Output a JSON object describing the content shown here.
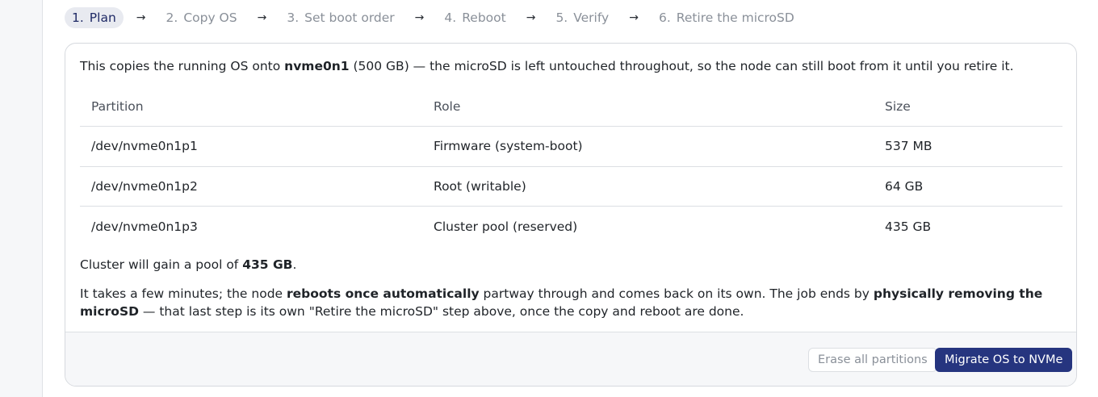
{
  "stepper": {
    "steps": [
      {
        "num": "1.",
        "label": "Plan"
      },
      {
        "num": "2.",
        "label": "Copy OS"
      },
      {
        "num": "3.",
        "label": "Set boot order"
      },
      {
        "num": "4.",
        "label": "Reboot"
      },
      {
        "num": "5.",
        "label": "Verify"
      },
      {
        "num": "6.",
        "label": "Retire the microSD"
      }
    ],
    "arrow": "→",
    "active_step": "Plan"
  },
  "intro": {
    "before": "This copies the running OS onto ",
    "device": "nvme0n1",
    "after": " (500 GB) — the microSD is left untouched throughout, so the node can still boot from it until you retire it."
  },
  "table": {
    "headers": {
      "partition": "Partition",
      "role": "Role",
      "size": "Size"
    },
    "rows": [
      {
        "partition": "/dev/nvme0n1p1",
        "role": "Firmware (system-boot)",
        "size": "537 MB"
      },
      {
        "partition": "/dev/nvme0n1p2",
        "role": "Root (writable)",
        "size": "64 GB"
      },
      {
        "partition": "/dev/nvme0n1p3",
        "role": "Cluster pool (reserved)",
        "size": "435 GB"
      }
    ]
  },
  "gain": {
    "before": "Cluster will gain a pool of ",
    "amount": "435 GB",
    "after": "."
  },
  "note": {
    "part1": "It takes a few minutes; the node ",
    "bold1": "reboots once automatically",
    "part2": " partway through and comes back on its own. The job ends by ",
    "bold2": "physically removing the microSD",
    "part3": " — that last step is its own \"Retire the microSD\" step above, once the copy and reboot are done."
  },
  "footer": {
    "erase_label": "Erase all partitions",
    "migrate_label": "Migrate OS to NVMe"
  },
  "colors": {
    "accent": "#26357f",
    "active_step_bg": "#e8eaf0",
    "muted_text": "#8a9099"
  }
}
